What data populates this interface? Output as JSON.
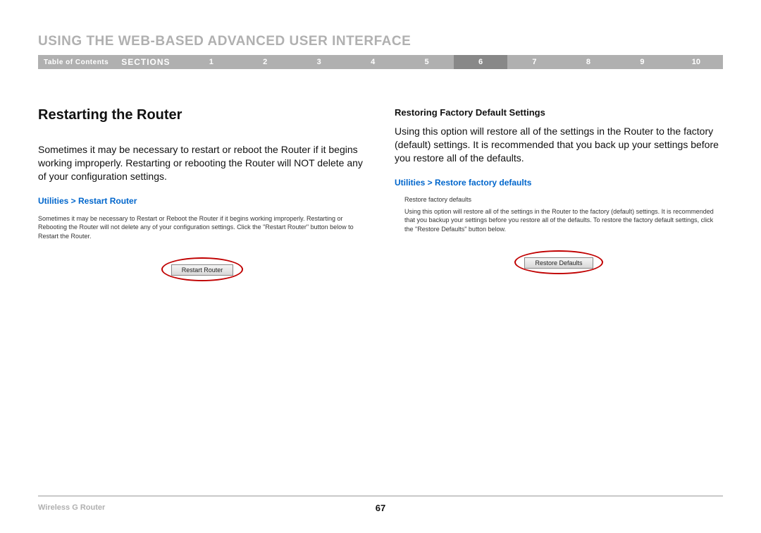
{
  "header": {
    "title": "USING THE WEB-BASED ADVANCED USER INTERFACE"
  },
  "nav": {
    "toc": "Table of Contents",
    "sections_label": "SECTIONS",
    "items": [
      "1",
      "2",
      "3",
      "4",
      "5",
      "6",
      "7",
      "8",
      "9",
      "10"
    ],
    "active_index": 5
  },
  "left": {
    "heading": "Restarting the Router",
    "body": "Sometimes it may be necessary to restart or reboot the Router if it begins working improperly. Restarting or rebooting the Router will NOT delete any of your configuration settings.",
    "link": "Utilities > Restart Router",
    "small_body": "Sometimes it may be necessary to Restart or Reboot the Router if it begins working improperly. Restarting or Rebooting the Router will not delete any of your configuration settings. Click the \"Restart Router\" button below to Restart the Router.",
    "button": "Restart Router"
  },
  "right": {
    "sub_heading": "Restoring Factory Default Settings",
    "body": "Using this option will restore all of the settings in the Router to the factory (default) settings. It is recommended that you back up your settings before you restore all of the defaults.",
    "link": "Utilities > Restore factory defaults",
    "small_heading": "Restore factory defaults",
    "small_body": "Using this option will restore all of the settings in the Router to the factory (default) settings. It is recommended that you backup your settings before you restore all of the defaults. To restore the factory default settings, click the \"Restore Defaults\" button below.",
    "button": "Restore Defaults"
  },
  "footer": {
    "product": "Wireless G Router",
    "page": "67"
  }
}
